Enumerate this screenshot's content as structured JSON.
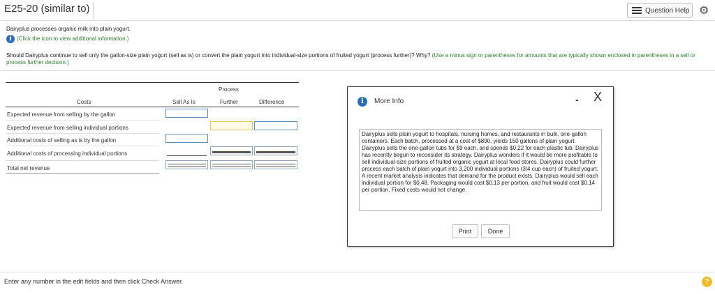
{
  "header": {
    "title": "E25-20 (similar to)",
    "question_help_label": "Question Help",
    "question_help_icon": "list-icon",
    "settings_icon": "gear-icon"
  },
  "intro": {
    "text": "Dairyplus processes organic milk into plain yogurt.",
    "info_link": "(Click the icon to view additional information.)"
  },
  "question": {
    "text": "Should Dairyplus continue to sell only the gallon-size plain yogurt (sell as is) or convert the plain yogurt into individual-size portions of fruited yogurt (process further)? Why?",
    "hint": "(Use a minus sign or parentheses for amounts that are typically shown enclosed in parentheses in a sell or process further decision.)"
  },
  "table": {
    "header_process": "Process",
    "header_costs": "Costs",
    "header_sell_as_is": "Sell As Is",
    "header_further": "Further",
    "header_difference": "Difference",
    "rows": [
      "Expected revenue from selling by the gallon",
      "Expected revenue from selling individual portions",
      "Additional costs of selling as is by the gallon",
      "Additional costs of processing individual portions",
      "Total net revenue"
    ]
  },
  "popup": {
    "title": "More Info",
    "text": "Dairyplus sells plain yogurt to hospitals, nursing homes, and restaurants in bulk, one-gallon containers. Each batch, processed at a cost of $890, yields 150 gallons of plain yogurt. Dairyplus sells the one-gallon tubs for $9 each, and spends $0.22 for each plastic tub. Dairyplus has recently begun to reconsider its strategy. Dairyplus wonders if it would be more profitable to sell individual-size portions of fruited organic yogurt at local food stores. Dairyplus could further process each batch of plain yogurt into 3,200 individual portions (3/4 cup each) of fruited yogurt. A recent market analysis indicates that demand for the product exists. Dairyplus would sell each individual portion for $0.48. Packaging would cost $0.13 per portion, and fruit would cost $0.14 per portion. Fixed costs would not change.",
    "print_label": "Print",
    "done_label": "Done",
    "minimize_glyph": "-",
    "close_glyph": "X"
  },
  "footer": {
    "text": "Enter any number in the edit fields and then click Check Answer.",
    "help_glyph": "?"
  },
  "colors": {
    "info_blue": "#2a6ebb",
    "hint_green": "#2e7d32",
    "input_border": "#5a8fc0",
    "active_input": "#e8c45a",
    "help_yellow": "#f2b928"
  }
}
